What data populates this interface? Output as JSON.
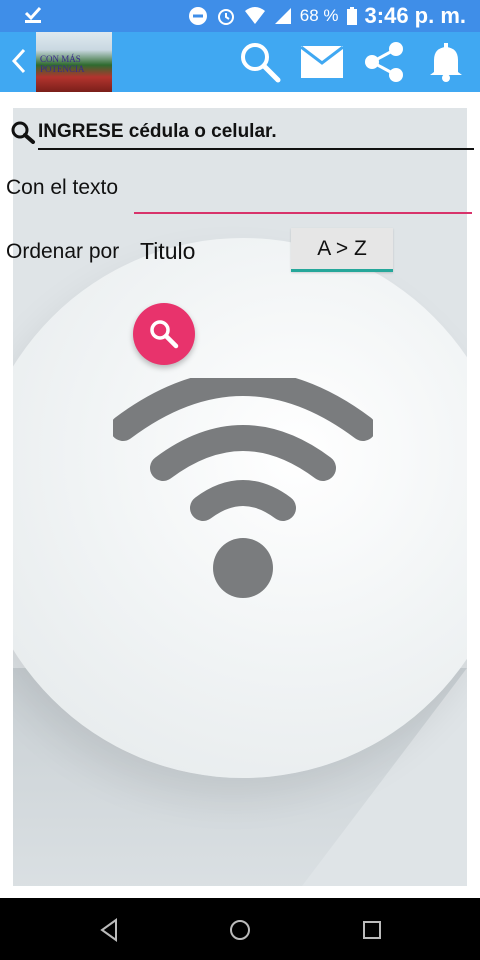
{
  "status_bar": {
    "time": "3:46 p. m.",
    "battery_percent": "68 %",
    "icons": [
      "download-done-icon",
      "do-not-disturb-icon",
      "alarm-icon",
      "wifi-signal-icon",
      "cell-signal-icon",
      "battery-icon"
    ]
  },
  "app_bar": {
    "logo_text": "CON MÁS POTENCIA",
    "actions": [
      "search-icon",
      "mail-icon",
      "share-icon",
      "bell-icon"
    ],
    "colors": {
      "background": "#40a8f2",
      "status_bar": "#3f8ee8"
    }
  },
  "search": {
    "placeholder": "INGRESE cédula o celular.",
    "value": ""
  },
  "filter": {
    "text_label": "Con el texto",
    "text_value": ""
  },
  "sort": {
    "label": "Ordenar por",
    "field": "Titulo",
    "order_button": "A > Z"
  },
  "colors": {
    "accent": "#e8336c",
    "sort_underline": "#26a79a",
    "wifi_icon": "#7a7c7e"
  }
}
